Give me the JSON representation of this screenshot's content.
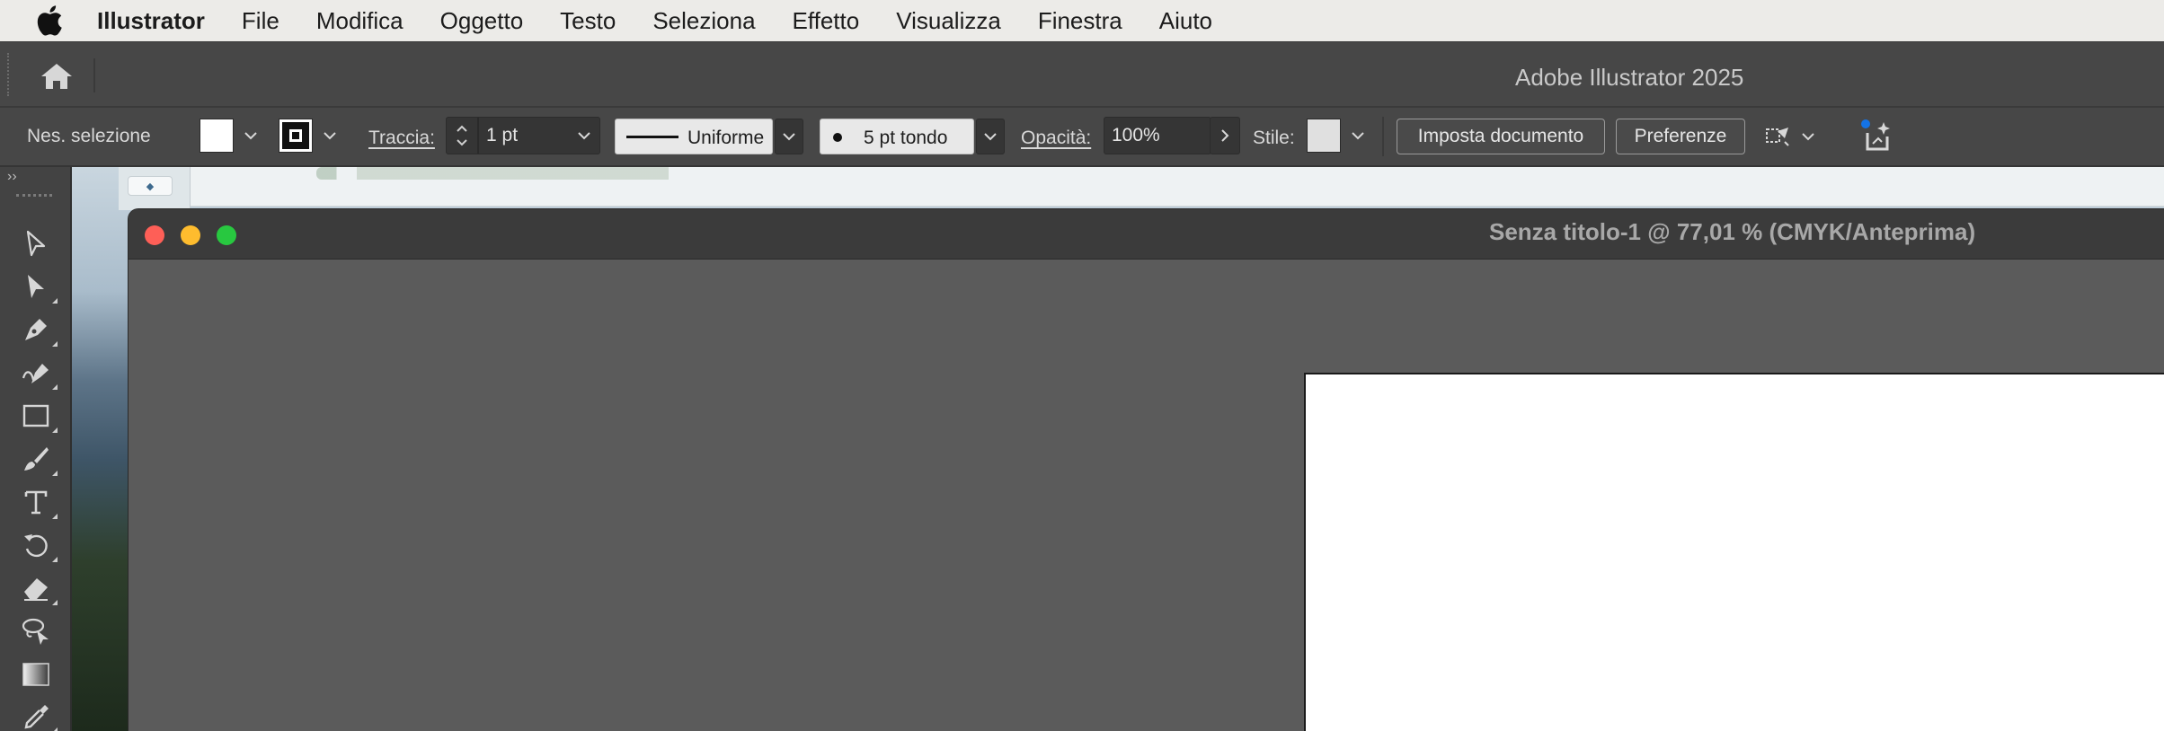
{
  "menubar": {
    "apple_icon": "apple-logo-icon",
    "app_name": "Illustrator",
    "items": [
      "File",
      "Modifica",
      "Oggetto",
      "Testo",
      "Seleziona",
      "Effetto",
      "Visualizza",
      "Finestra",
      "Aiuto"
    ]
  },
  "appbar": {
    "home_icon": "home-icon",
    "title": "Adobe Illustrator 2025"
  },
  "controlbar": {
    "selection_status": "Nes. selezione",
    "stroke_label": "Traccia:",
    "stroke_weight": "1 pt",
    "profile_label": "Uniforme",
    "brush_label": "5 pt tondo",
    "opacity_label": "Opacità:",
    "opacity_value": "100%",
    "style_label": "Stile:",
    "document_setup_button": "Imposta documento",
    "preferences_button": "Preferenze"
  },
  "toolpanel": {
    "collapse_label": "››",
    "tools": [
      {
        "name": "selection-tool-icon"
      },
      {
        "name": "direct-selection-tool-icon"
      },
      {
        "name": "pen-tool-icon"
      },
      {
        "name": "curvature-tool-icon"
      },
      {
        "name": "rectangle-tool-icon"
      },
      {
        "name": "paintbrush-tool-icon"
      },
      {
        "name": "type-tool-icon"
      },
      {
        "name": "rotate-tool-icon"
      },
      {
        "name": "eraser-tool-icon"
      },
      {
        "name": "lasso-tool-icon"
      },
      {
        "name": "gradient-tool-icon"
      },
      {
        "name": "eyedropper-tool-icon"
      }
    ]
  },
  "document": {
    "title": "Senza titolo-1 @ 77,01 % (CMYK/Anteprima)"
  },
  "colors": {
    "close": "#fe5f57",
    "minimize": "#febc2e",
    "zoom": "#28c840",
    "fill_swatch": "#ffffff",
    "accent": "#1473e6"
  }
}
